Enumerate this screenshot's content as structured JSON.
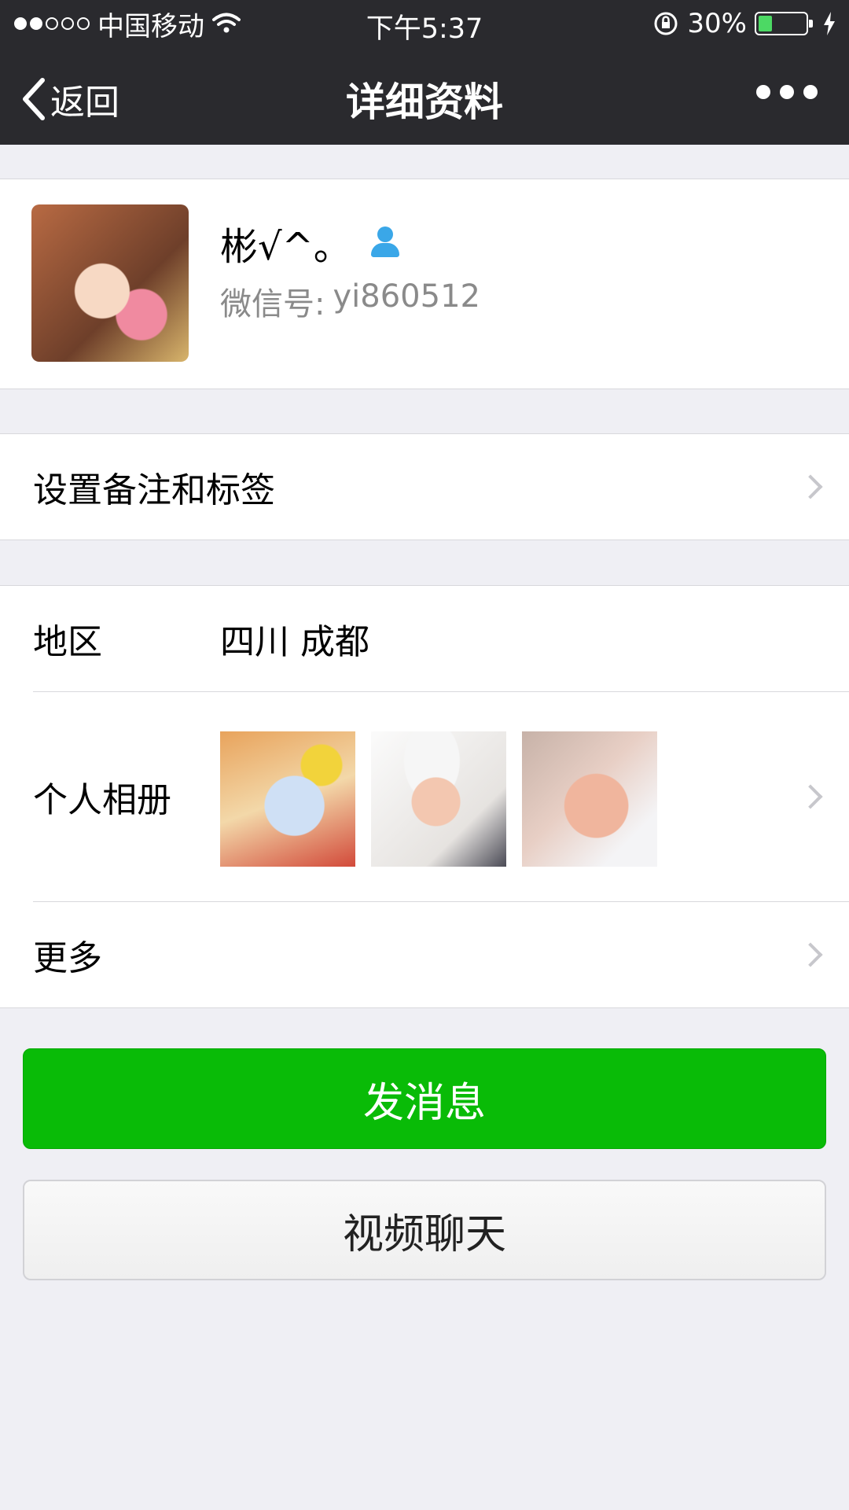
{
  "status_bar": {
    "carrier": "中国移动",
    "time": "下午5:37",
    "battery_percent": "30%",
    "battery_level": 0.3,
    "signal_bars_filled": 2,
    "signal_bars_total": 5
  },
  "nav": {
    "back_label": "返回",
    "title": "详细资料"
  },
  "profile": {
    "name": "彬√^。",
    "wechat_label": "微信号:",
    "wechat_id": "yi860512"
  },
  "remark_row": {
    "label": "设置备注和标签"
  },
  "details": {
    "region_label": "地区",
    "region_value": "四川 成都",
    "album_label": "个人相册",
    "more_label": "更多"
  },
  "actions": {
    "send_message": "发消息",
    "video_chat": "视频聊天"
  },
  "colors": {
    "primary_green": "#09bb07",
    "nav_bg": "#2a2a2e",
    "page_bg": "#efeff4",
    "verify_icon": "#3aa7e8"
  }
}
